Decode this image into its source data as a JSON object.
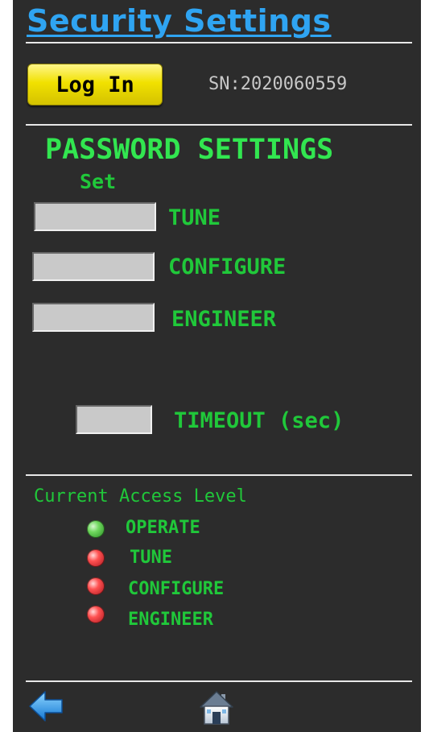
{
  "header": {
    "title": "Security Settings"
  },
  "login": {
    "label": "Log In"
  },
  "device": {
    "serial": "SN:2020060559"
  },
  "password_settings": {
    "heading": "PASSWORD SETTINGS",
    "set_label": "Set",
    "fields": [
      {
        "label": "TUNE",
        "value": ""
      },
      {
        "label": "CONFIGURE",
        "value": ""
      },
      {
        "label": "ENGINEER",
        "value": ""
      }
    ],
    "timeout": {
      "label": "TIMEOUT (sec)",
      "value": ""
    }
  },
  "access": {
    "heading": "Current Access Level",
    "levels": [
      {
        "label": "OPERATE",
        "status": "active",
        "color": "#4ccc3a"
      },
      {
        "label": "TUNE",
        "status": "inactive",
        "color": "#e8262e"
      },
      {
        "label": "CONFIGURE",
        "status": "inactive",
        "color": "#e8262e"
      },
      {
        "label": "ENGINEER",
        "status": "inactive",
        "color": "#e8262e"
      }
    ]
  },
  "nav": {
    "back_icon": "back-arrow-icon",
    "home_icon": "home-icon"
  },
  "colors": {
    "title": "#2fa4f2",
    "accent_green": "#20c83a",
    "button_yellow": "#f1e100",
    "background": "#2c2c2c"
  }
}
